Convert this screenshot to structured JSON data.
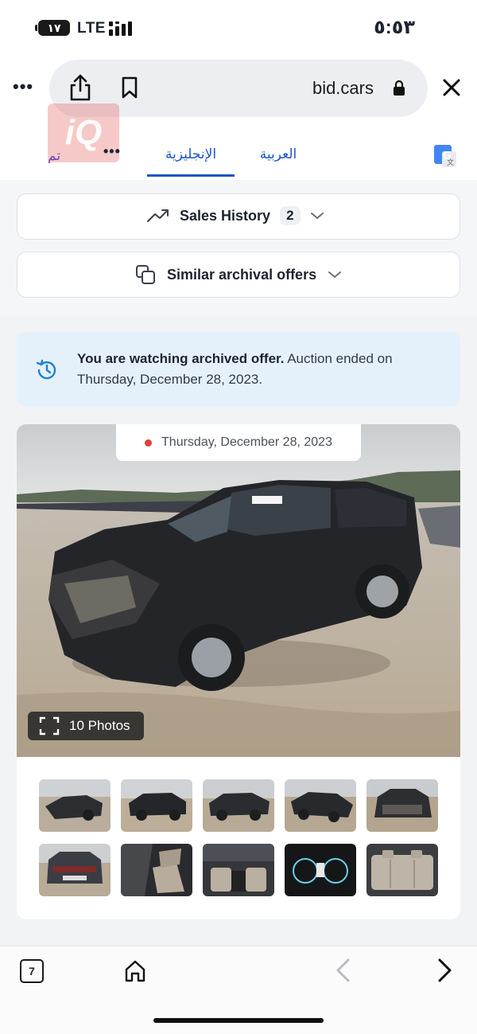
{
  "status_bar": {
    "battery": "١٧",
    "network": "LTE",
    "time": "٥:٥٣"
  },
  "browser": {
    "domain": "bid.cars",
    "more": "•••"
  },
  "translate_bar": {
    "done": "تم",
    "more": "•••",
    "tab_english": "الإنجليزية",
    "tab_arabic": "العربية",
    "watermark": "iQ"
  },
  "sales_history": {
    "label": "Sales History",
    "count": "2"
  },
  "similar_offers": {
    "label": "Similar archival offers"
  },
  "notice": {
    "bold": "You are watching archived offer.",
    "rest": " Auction ended on Thursday, December 28, 2023."
  },
  "photo": {
    "date": "Thursday, December 28, 2023",
    "photos_label": "10 Photos",
    "plate": "7B23 3904"
  },
  "thumbnails": [
    {
      "kind": "front-left-damaged"
    },
    {
      "kind": "rear-left"
    },
    {
      "kind": "rear-left-2"
    },
    {
      "kind": "front-right"
    },
    {
      "kind": "front-damaged"
    },
    {
      "kind": "rear"
    },
    {
      "kind": "interior-front"
    },
    {
      "kind": "dashboard"
    },
    {
      "kind": "instrument-cluster"
    },
    {
      "kind": "rear-seats"
    }
  ],
  "toolbar": {
    "tabs_count": "7"
  },
  "colors": {
    "link_blue": "#1a56c9",
    "notice_bg": "#e4f1fb",
    "accent_red": "#e0413a"
  }
}
